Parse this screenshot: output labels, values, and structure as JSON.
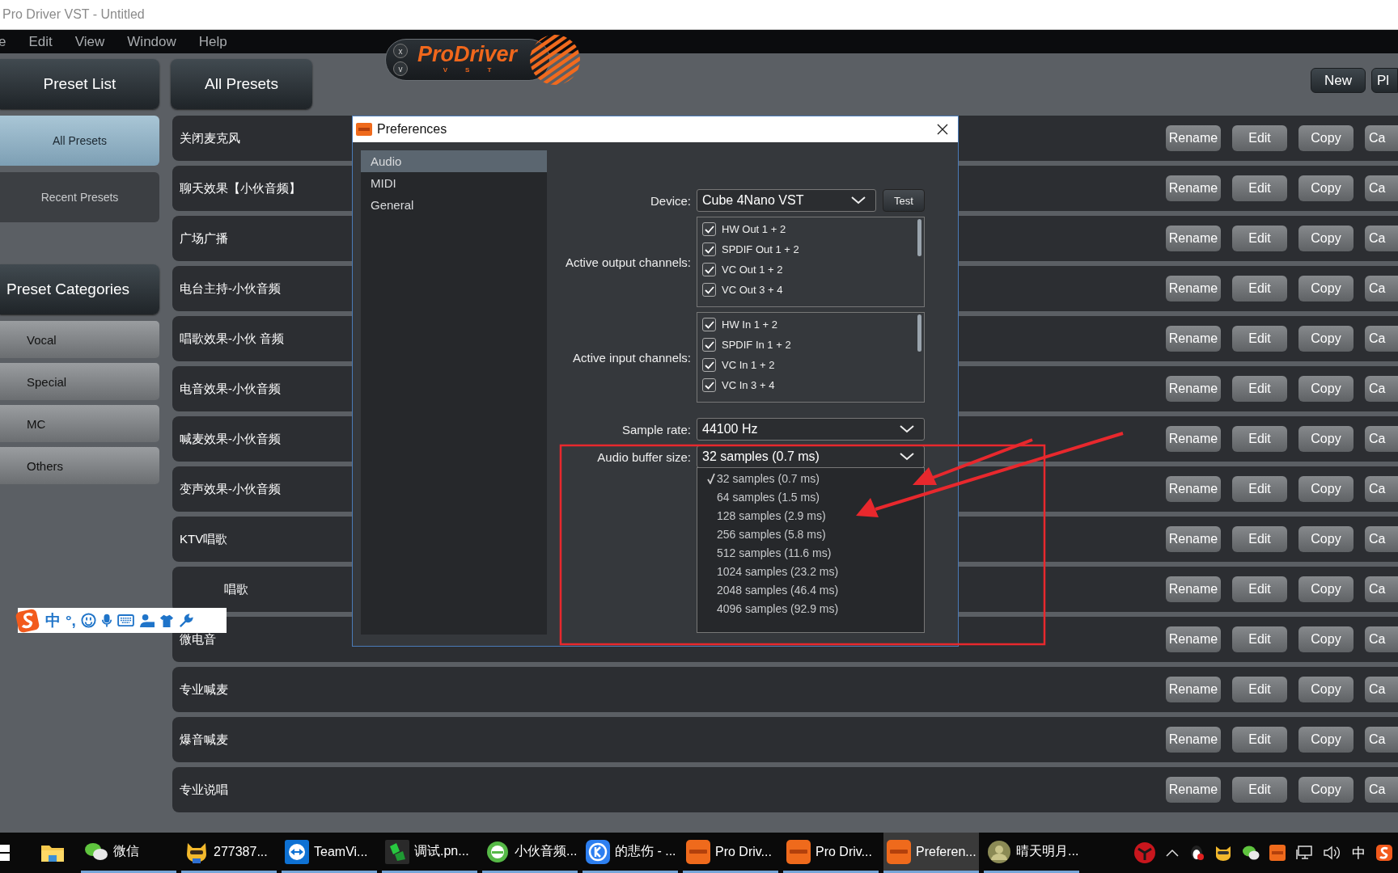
{
  "window": {
    "title": "Pro Driver VST - Untitled"
  },
  "menu": [
    "e",
    "Edit",
    "View",
    "Window",
    "Help"
  ],
  "logo": {
    "name": "ProDriver",
    "sub": "VST",
    "buttons": [
      "x",
      "v"
    ]
  },
  "sidebar": {
    "header": "Preset List",
    "items": [
      {
        "label": "All Presets",
        "selected": true
      },
      {
        "label": "Recent Presets",
        "selected": false
      }
    ],
    "categories_header": "Preset Categories",
    "categories": [
      "Vocal",
      "Special",
      "MC",
      "Others"
    ]
  },
  "presets": {
    "header": "All Presets",
    "toolbar": [
      "New",
      "Pl"
    ],
    "rows": [
      {
        "name": "关闭麦克风",
        "covered": false,
        "buttons": [
          "Rename",
          "Edit",
          "Copy",
          "Ca"
        ]
      },
      {
        "name": "聊天效果【小伙音频】",
        "covered": false,
        "buttons": [
          "Rename",
          "Edit",
          "Copy",
          "Ca"
        ]
      },
      {
        "name": "广场广播",
        "covered": false,
        "buttons": [
          "Rename",
          "Edit",
          "Copy",
          "Ca"
        ]
      },
      {
        "name": "电台主持-小伙音频",
        "covered": false,
        "buttons": [
          "Rename",
          "Edit",
          "Copy",
          "Ca"
        ]
      },
      {
        "name": "唱歌效果-小伙 音频",
        "covered": false,
        "buttons": [
          "Rename",
          "Edit",
          "Copy",
          "Ca"
        ]
      },
      {
        "name": "电音效果-小伙音频",
        "covered": false,
        "buttons": [
          "Rename",
          "Edit",
          "Copy",
          "Ca"
        ]
      },
      {
        "name": "喊麦效果-小伙音频",
        "covered": false,
        "buttons": [
          "Rename",
          "Edit",
          "Copy",
          "Ca"
        ]
      },
      {
        "name": "变声效果-小伙音频",
        "covered": false,
        "buttons": [
          "Rename",
          "Edit",
          "Copy",
          "Ca"
        ]
      },
      {
        "name": "KTV唱歌",
        "covered": false,
        "buttons": [
          "Rename",
          "Edit",
          "Copy",
          "Ca"
        ]
      },
      {
        "name": "唱歌",
        "covered": true,
        "buttons": [
          "Rename",
          "Edit",
          "Copy",
          "Ca"
        ]
      },
      {
        "name": "微电音",
        "covered": false,
        "buttons": [
          "Rename",
          "Edit",
          "Copy",
          "Ca"
        ]
      },
      {
        "name": "专业喊麦",
        "covered": false,
        "buttons": [
          "Rename",
          "Edit",
          "Copy",
          "Ca"
        ]
      },
      {
        "name": "爆音喊麦",
        "covered": false,
        "buttons": [
          "Rename",
          "Edit",
          "Copy",
          "Ca"
        ]
      },
      {
        "name": "专业说唱",
        "covered": false,
        "buttons": [
          "Rename",
          "Edit",
          "Copy",
          "Ca"
        ]
      }
    ]
  },
  "preferences": {
    "title": "Preferences",
    "nav": [
      {
        "label": "Audio",
        "selected": true
      },
      {
        "label": "MIDI",
        "selected": false
      },
      {
        "label": "General",
        "selected": false
      }
    ],
    "device": {
      "label": "Device:",
      "value": "Cube 4Nano VST",
      "button": "Test"
    },
    "output_channels": {
      "label": "Active output channels:",
      "items": [
        {
          "label": "HW Out 1 + 2",
          "checked": true
        },
        {
          "label": "SPDIF Out 1 + 2",
          "checked": true
        },
        {
          "label": "VC Out 1 + 2",
          "checked": true
        },
        {
          "label": "VC Out 3 + 4",
          "checked": true
        }
      ]
    },
    "input_channels": {
      "label": "Active input channels:",
      "items": [
        {
          "label": "HW In 1 + 2",
          "checked": true
        },
        {
          "label": "SPDIF In 1 + 2",
          "checked": true
        },
        {
          "label": "VC In 1 + 2",
          "checked": true
        },
        {
          "label": "VC In 3 + 4",
          "checked": true
        }
      ]
    },
    "sample_rate": {
      "label": "Sample rate:",
      "value": "44100 Hz"
    },
    "buffer_size": {
      "label": "Audio buffer size:",
      "value": "32 samples (0.7 ms)",
      "expanded": true,
      "options": [
        {
          "label": "32 samples (0.7 ms)",
          "selected": true
        },
        {
          "label": "64 samples (1.5 ms)",
          "selected": false
        },
        {
          "label": "128 samples (2.9 ms)",
          "selected": false
        },
        {
          "label": "256 samples (5.8 ms)",
          "selected": false
        },
        {
          "label": "512 samples (11.6 ms)",
          "selected": false
        },
        {
          "label": "1024 samples (23.2 ms)",
          "selected": false
        },
        {
          "label": "2048 samples (46.4 ms)",
          "selected": false
        },
        {
          "label": "4096 samples (92.9 ms)",
          "selected": false
        }
      ]
    }
  },
  "ime_bar": {
    "texts": [
      "中",
      "°,"
    ]
  },
  "taskbar": {
    "items": [
      {
        "label": "微信",
        "kind": "chat",
        "selected": false
      },
      {
        "label": "277387...",
        "kind": "cat",
        "selected": false
      },
      {
        "label": "TeamVi...",
        "kind": "remote",
        "selected": false
      },
      {
        "label": "调试.pn...",
        "kind": "green",
        "selected": false
      },
      {
        "label": "小伙音频...",
        "kind": "circle",
        "selected": false
      },
      {
        "label": "的悲伤 - ...",
        "kind": "blue",
        "selected": false
      },
      {
        "label": "Pro Driv...",
        "kind": "app",
        "selected": false
      },
      {
        "label": "Pro Driv...",
        "kind": "app",
        "selected": false
      },
      {
        "label": "Preferen...",
        "kind": "app",
        "selected": true
      },
      {
        "label": "晴天明月...",
        "kind": "avatar",
        "selected": false
      }
    ],
    "language": "中"
  }
}
